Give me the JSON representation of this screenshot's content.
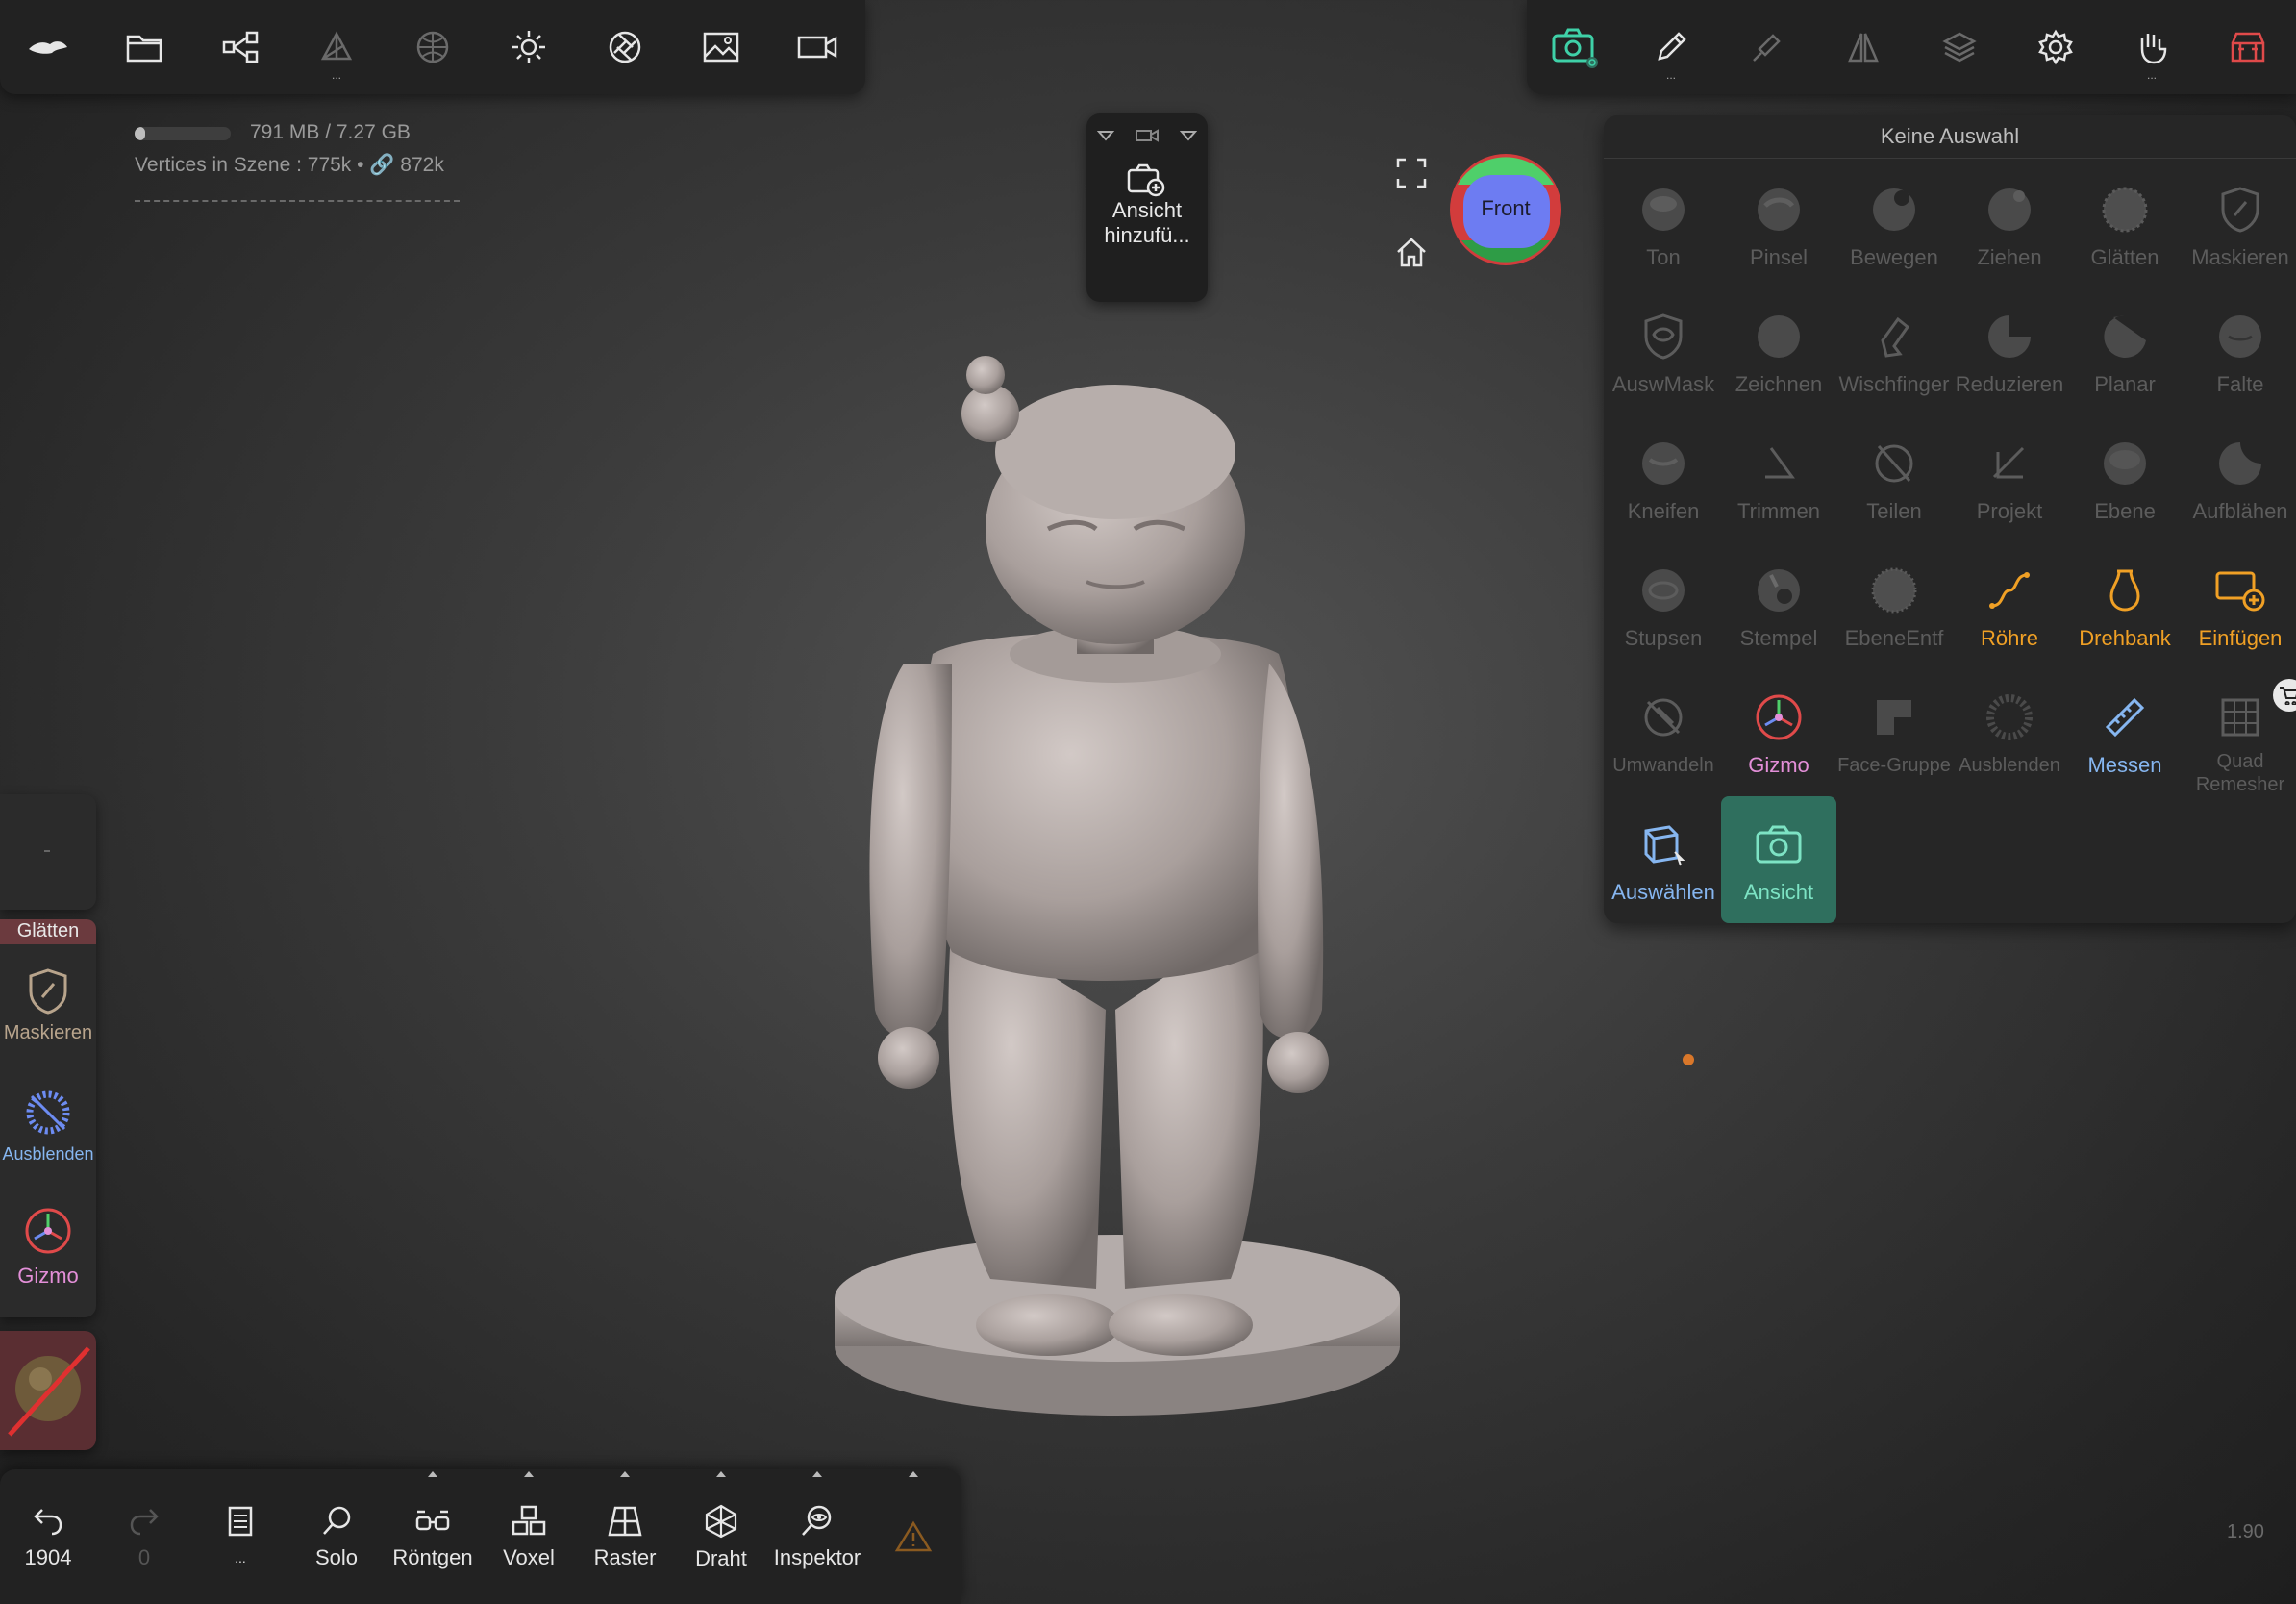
{
  "stats": {
    "memory": "791 MB / 7.27 GB",
    "memory_fraction": 0.11,
    "vertices": "Vertices in Szene : 775k • 🔗 872k"
  },
  "view_widget": {
    "add_view_label_line1": "Ansicht",
    "add_view_label_line2": "hinzufü..."
  },
  "gizmo_cube": {
    "label": "Front"
  },
  "panel": {
    "title": "Keine Auswahl",
    "tools": [
      {
        "label": "Ton"
      },
      {
        "label": "Pinsel"
      },
      {
        "label": "Bewegen"
      },
      {
        "label": "Ziehen"
      },
      {
        "label": "Glätten"
      },
      {
        "label": "Maskieren"
      },
      {
        "label": "AuswMask"
      },
      {
        "label": "Zeichnen"
      },
      {
        "label": "Wischfinger"
      },
      {
        "label": "Reduzieren"
      },
      {
        "label": "Planar"
      },
      {
        "label": "Falte"
      },
      {
        "label": "Kneifen"
      },
      {
        "label": "Trimmen"
      },
      {
        "label": "Teilen"
      },
      {
        "label": "Projekt"
      },
      {
        "label": "Ebene"
      },
      {
        "label": "Aufblähen"
      },
      {
        "label": "Stupsen"
      },
      {
        "label": "Stempel"
      },
      {
        "label": "EbeneEntf"
      },
      {
        "label": "Röhre"
      },
      {
        "label": "Drehbank"
      },
      {
        "label": "Einfügen"
      },
      {
        "label": "Umwandeln"
      },
      {
        "label": "Gizmo"
      },
      {
        "label": "Face-Gruppe"
      },
      {
        "label": "Ausblenden"
      },
      {
        "label": "Messen"
      },
      {
        "label": "Quad Remesher"
      },
      {
        "label": "Auswählen"
      },
      {
        "label": "Ansicht"
      }
    ]
  },
  "left_panel": {
    "top_label": "Glätten",
    "items": [
      {
        "label": "Maskieren"
      },
      {
        "label": "Ausblenden"
      },
      {
        "label": "Gizmo"
      }
    ]
  },
  "bottom_bar": {
    "undo_count": "1904",
    "redo_count": "0",
    "menu_dots": "...",
    "solo": "Solo",
    "xray": "Röntgen",
    "voxel": "Voxel",
    "grid": "Raster",
    "wire": "Draht",
    "inspector": "Inspektor"
  },
  "version": "1.90",
  "colors": {
    "accent_teal": "#3fd1a8",
    "orange": "#f0a025",
    "pink": "#e38fd8",
    "blue": "#86b6f0",
    "red": "#e04a4a"
  }
}
